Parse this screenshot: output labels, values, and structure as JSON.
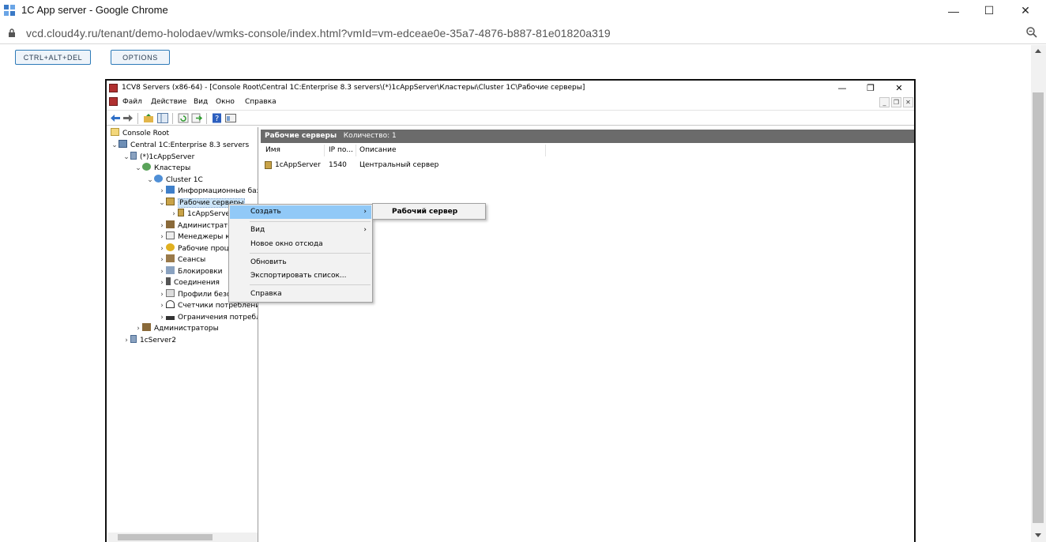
{
  "browser": {
    "title": "1C App server - Google Chrome",
    "url": "vcd.cloud4y.ru/tenant/demo-holodaev/wmks-console/index.html?vmId=vm-edceae0e-35a7-4876-b887-81e01820a319",
    "minimize": "—",
    "maximize": "☐",
    "close": "✕"
  },
  "console_buttons": {
    "ctrl_alt_del": "CTRL+ALT+DEL",
    "options": "OPTIONS"
  },
  "mmc": {
    "title": "1CV8 Servers (x86-64) - [Console Root\\Central 1C:Enterprise 8.3 servers\\(*)1cAppServer\\Кластеры\\Cluster 1C\\Рабочие серверы]",
    "menu": [
      "Файл",
      "Действие",
      "Вид",
      "Окно",
      "Справка"
    ],
    "tree": [
      {
        "label": "Console Root",
        "arrow": "",
        "icon": "folder-icon"
      },
      {
        "label": "Central 1C:Enterprise 8.3 servers",
        "arrow": "⌄",
        "icon": "servers-icon"
      },
      {
        "label": "(*)1cAppServer",
        "arrow": "⌄",
        "icon": "server-icon"
      },
      {
        "label": "Кластеры",
        "arrow": "⌄",
        "icon": "clusters-icon"
      },
      {
        "label": "Cluster 1C",
        "arrow": "⌄",
        "icon": "cluster-icon"
      },
      {
        "label": "Информационные базы",
        "arrow": "›",
        "icon": "database-icon"
      },
      {
        "label": "Рабочие серверы",
        "arrow": "⌄",
        "icon": "workservers-icon"
      },
      {
        "label": "1cAppServer",
        "arrow": "›",
        "icon": "workserver-icon"
      },
      {
        "label": "Администраторы",
        "arrow": "›",
        "icon": "admins-icon"
      },
      {
        "label": "Менеджеры кластера",
        "arrow": "›",
        "icon": "managers-icon"
      },
      {
        "label": "Рабочие процессы",
        "arrow": "›",
        "icon": "processes-icon"
      },
      {
        "label": "Сеансы",
        "arrow": "›",
        "icon": "sessions-icon"
      },
      {
        "label": "Блокировки",
        "arrow": "›",
        "icon": "locks-icon"
      },
      {
        "label": "Соединения",
        "arrow": "›",
        "icon": "connections-icon"
      },
      {
        "label": "Профили безопасности",
        "arrow": "›",
        "icon": "profiles-icon"
      },
      {
        "label": "Счетчики потребления",
        "arrow": "›",
        "icon": "counters-icon"
      },
      {
        "label": "Ограничения потребления",
        "arrow": "›",
        "icon": "limits-icon"
      },
      {
        "label": "Администраторы",
        "arrow": "›",
        "icon": "admins-icon"
      },
      {
        "label": "1cServer2",
        "arrow": "›",
        "icon": "server-icon"
      }
    ],
    "result": {
      "header_title": "Рабочие серверы",
      "header_count": "Количество: 1",
      "columns": [
        "Имя",
        "IP по...",
        "Описание"
      ],
      "rows": [
        {
          "name": "1cAppServer",
          "ip": "1540",
          "description": "Центральный сервер"
        }
      ]
    },
    "context_menu": {
      "items": [
        "Создать",
        "Вид",
        "Новое окно отсюда",
        "Обновить",
        "Экспортировать список...",
        "Справка"
      ],
      "submenu_arrow": "›",
      "submenu_items": [
        "Рабочий сервер"
      ]
    }
  },
  "colors": {
    "highlight": "#91c9f7",
    "header": "#6b6b6b",
    "button_border": "#2e7bb8"
  }
}
